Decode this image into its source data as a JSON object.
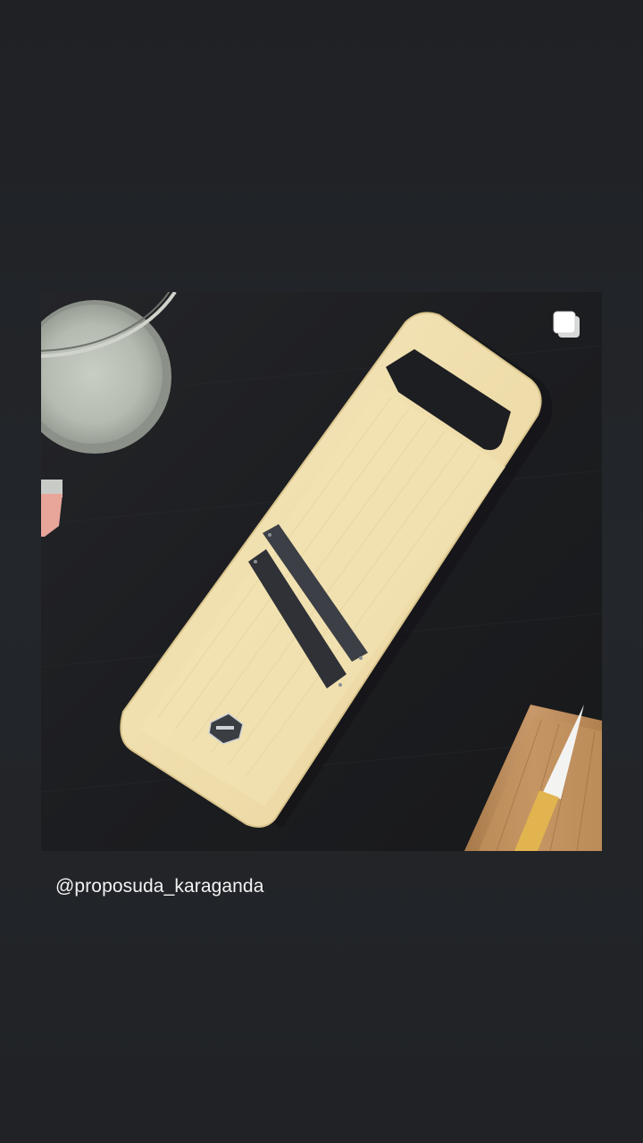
{
  "post": {
    "username": "@proposuda_karaganda",
    "media_type": "photo",
    "multi_image_icon": "carousel-stack-icon"
  },
  "colors": {
    "background": "#222427",
    "tabletop": "#1b1c1f",
    "slicer_body": "#f0dfad",
    "blade": "#2f3136",
    "cutting_board": "#b98a55",
    "knife_handle": "#e2b44f",
    "text": "#f3f3f3"
  }
}
